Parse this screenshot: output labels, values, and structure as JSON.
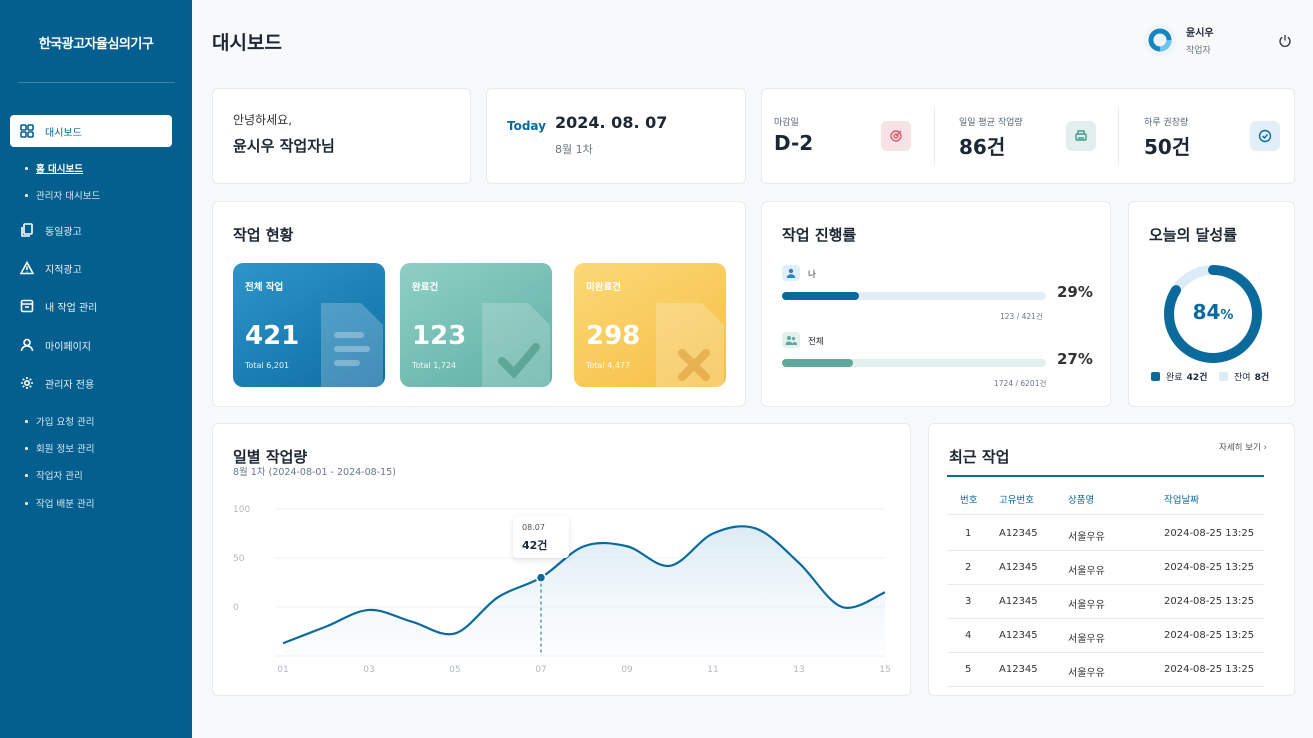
{
  "brand": "한국광고자율심의기구",
  "page_title": "대시보드",
  "user": {
    "name": "윤시우",
    "role": "작업자"
  },
  "sidebar": {
    "dashboard": "대시보드",
    "sub_dashboard": [
      "홈 대시보드",
      "관리자 대시보드"
    ],
    "items": [
      "동일광고",
      "지적광고",
      "내 작업 관리",
      "마이페이지",
      "관리자 전용"
    ],
    "sub_admin": [
      "가입 요청 관리",
      "회원 정보 관리",
      "작업자 관리",
      "작업 배분 관리"
    ]
  },
  "greeting": {
    "line1": "안녕하세요,",
    "line2": "윤시우 작업자님"
  },
  "today": {
    "label": "Today",
    "date": "2024. 08. 07",
    "week": "8월 1차"
  },
  "stats": [
    {
      "label": "마감일",
      "value": "D-2",
      "icon": "target-icon",
      "color": "#f7e3e6"
    },
    {
      "label": "일일 평균 작업량",
      "value": "86건",
      "icon": "printer-icon",
      "color": "#e2efed"
    },
    {
      "label": "하루 권장량",
      "value": "50건",
      "icon": "check-circle-icon",
      "color": "#e3eff8"
    }
  ],
  "work_status": {
    "title": "작업 현황",
    "tiles": [
      {
        "label": "전체 작업",
        "value": "421",
        "total": "Total 6,201"
      },
      {
        "label": "완료건",
        "value": "123",
        "total": "Total 1,724"
      },
      {
        "label": "미완료건",
        "value": "298",
        "total": "Total 4,477"
      }
    ]
  },
  "progress": {
    "title": "작업 진행률",
    "rows": [
      {
        "name": "나",
        "pct_label": "29%",
        "pct": 0.29,
        "count": "123 / 421건"
      },
      {
        "name": "전체",
        "pct_label": "27%",
        "pct": 0.27,
        "count": "1724 / 6201건"
      }
    ]
  },
  "achievement": {
    "title": "오늘의 달성률",
    "value": "84",
    "unit": "%",
    "fraction": 0.84,
    "done_label": "완료",
    "done_value": "42건",
    "remain_label": "잔여",
    "remain_value": "8건"
  },
  "daily": {
    "title": "일별 작업량",
    "subtitle": "8월 1차 (2024-08-01 - 2024-08-15)",
    "tooltip_date": "08.07",
    "tooltip_value": "42건"
  },
  "chart_data": {
    "type": "area",
    "title": "일별 작업량",
    "x_ticks": [
      "01",
      "03",
      "05",
      "07",
      "09",
      "11",
      "13",
      "15"
    ],
    "y_ticks": [
      "100",
      "50",
      "0"
    ],
    "ylim": [
      -50,
      100
    ],
    "grid": true,
    "points": [
      {
        "x": 1,
        "y": -37
      },
      {
        "x": 2,
        "y": -20
      },
      {
        "x": 3,
        "y": -3
      },
      {
        "x": 4,
        "y": -15
      },
      {
        "x": 5,
        "y": -27
      },
      {
        "x": 6,
        "y": 10
      },
      {
        "x": 7,
        "y": 30
      },
      {
        "x": 8,
        "y": 62
      },
      {
        "x": 9,
        "y": 62
      },
      {
        "x": 10,
        "y": 42
      },
      {
        "x": 11,
        "y": 75
      },
      {
        "x": 12,
        "y": 80
      },
      {
        "x": 13,
        "y": 45
      },
      {
        "x": 14,
        "y": 0
      },
      {
        "x": 15,
        "y": 15
      }
    ],
    "highlight_x": 7
  },
  "recent": {
    "title": "최근 작업",
    "more": "자세히 보기",
    "headers": [
      "번호",
      "고유번호",
      "상품명",
      "작업날짜"
    ],
    "rows": [
      [
        "1",
        "A12345",
        "서울우유",
        "2024-08-25 13:25"
      ],
      [
        "2",
        "A12345",
        "서울우유",
        "2024-08-25 13:25"
      ],
      [
        "3",
        "A12345",
        "서울우유",
        "2024-08-25 13:25"
      ],
      [
        "4",
        "A12345",
        "서울우유",
        "2024-08-25 13:25"
      ],
      [
        "5",
        "A12345",
        "서울우유",
        "2024-08-25 13:25"
      ]
    ]
  }
}
